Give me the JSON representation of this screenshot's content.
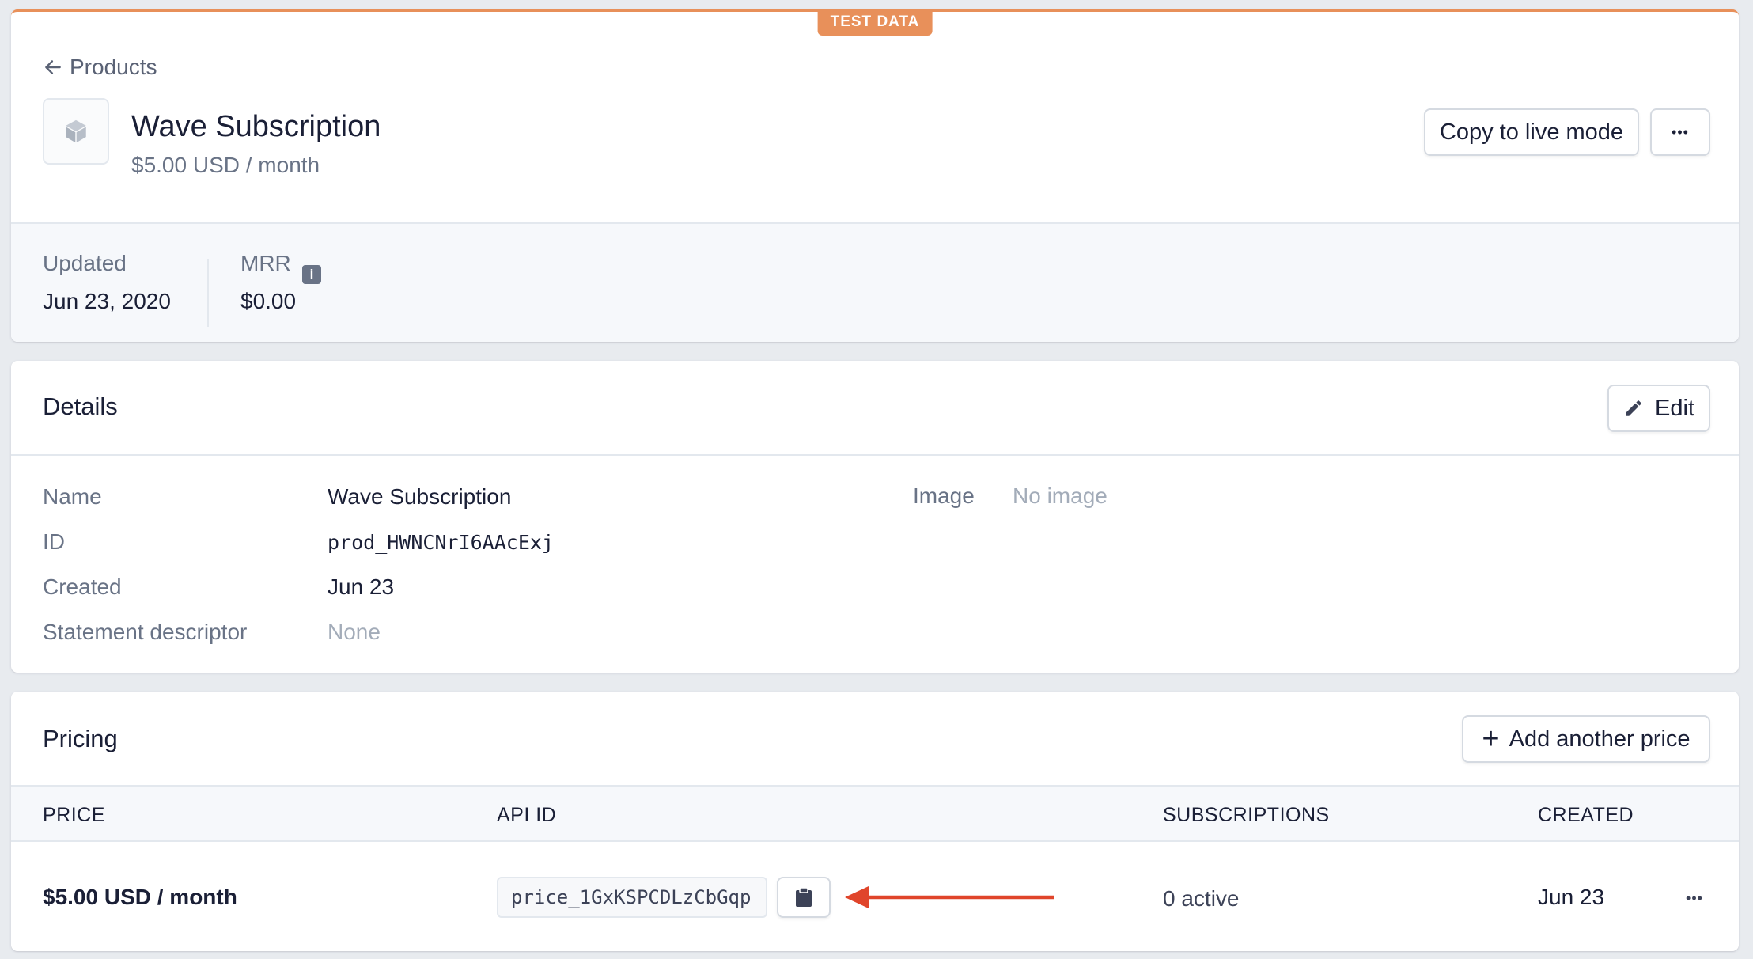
{
  "banner": {
    "label": "TEST DATA",
    "color": "#e8905a"
  },
  "breadcrumb": {
    "back_label": "Products"
  },
  "product": {
    "title": "Wave Subscription",
    "price": "$5.00 USD / month"
  },
  "actions": {
    "copy_live_label": "Copy to live mode",
    "more_label": "•••"
  },
  "stats": {
    "updated_label": "Updated",
    "updated_value": "Jun 23, 2020",
    "mrr_label": "MRR",
    "mrr_value": "$0.00",
    "info_glyph": "i"
  },
  "details": {
    "title": "Details",
    "edit_label": "Edit",
    "name_label": "Name",
    "name_value": "Wave Subscription",
    "id_label": "ID",
    "id_value": "prod_HWNCNrI6AAcExj",
    "created_label": "Created",
    "created_value": "Jun 23",
    "descriptor_label": "Statement descriptor",
    "descriptor_value": "None",
    "image_label": "Image",
    "image_value": "No image"
  },
  "pricing": {
    "title": "Pricing",
    "add_label": "Add another price",
    "add_glyph": "+",
    "columns": {
      "price": "PRICE",
      "api_id": "API ID",
      "subscriptions": "SUBSCRIPTIONS",
      "created": "CREATED"
    },
    "rows": [
      {
        "price": "$5.00 USD / month",
        "api_id": "price_1GxKSPCDLzCbGqp",
        "subscriptions": "0 active",
        "created": "Jun 23"
      }
    ],
    "row_more_label": "•••"
  },
  "annotation": {
    "arrow_color": "#e0452b"
  }
}
